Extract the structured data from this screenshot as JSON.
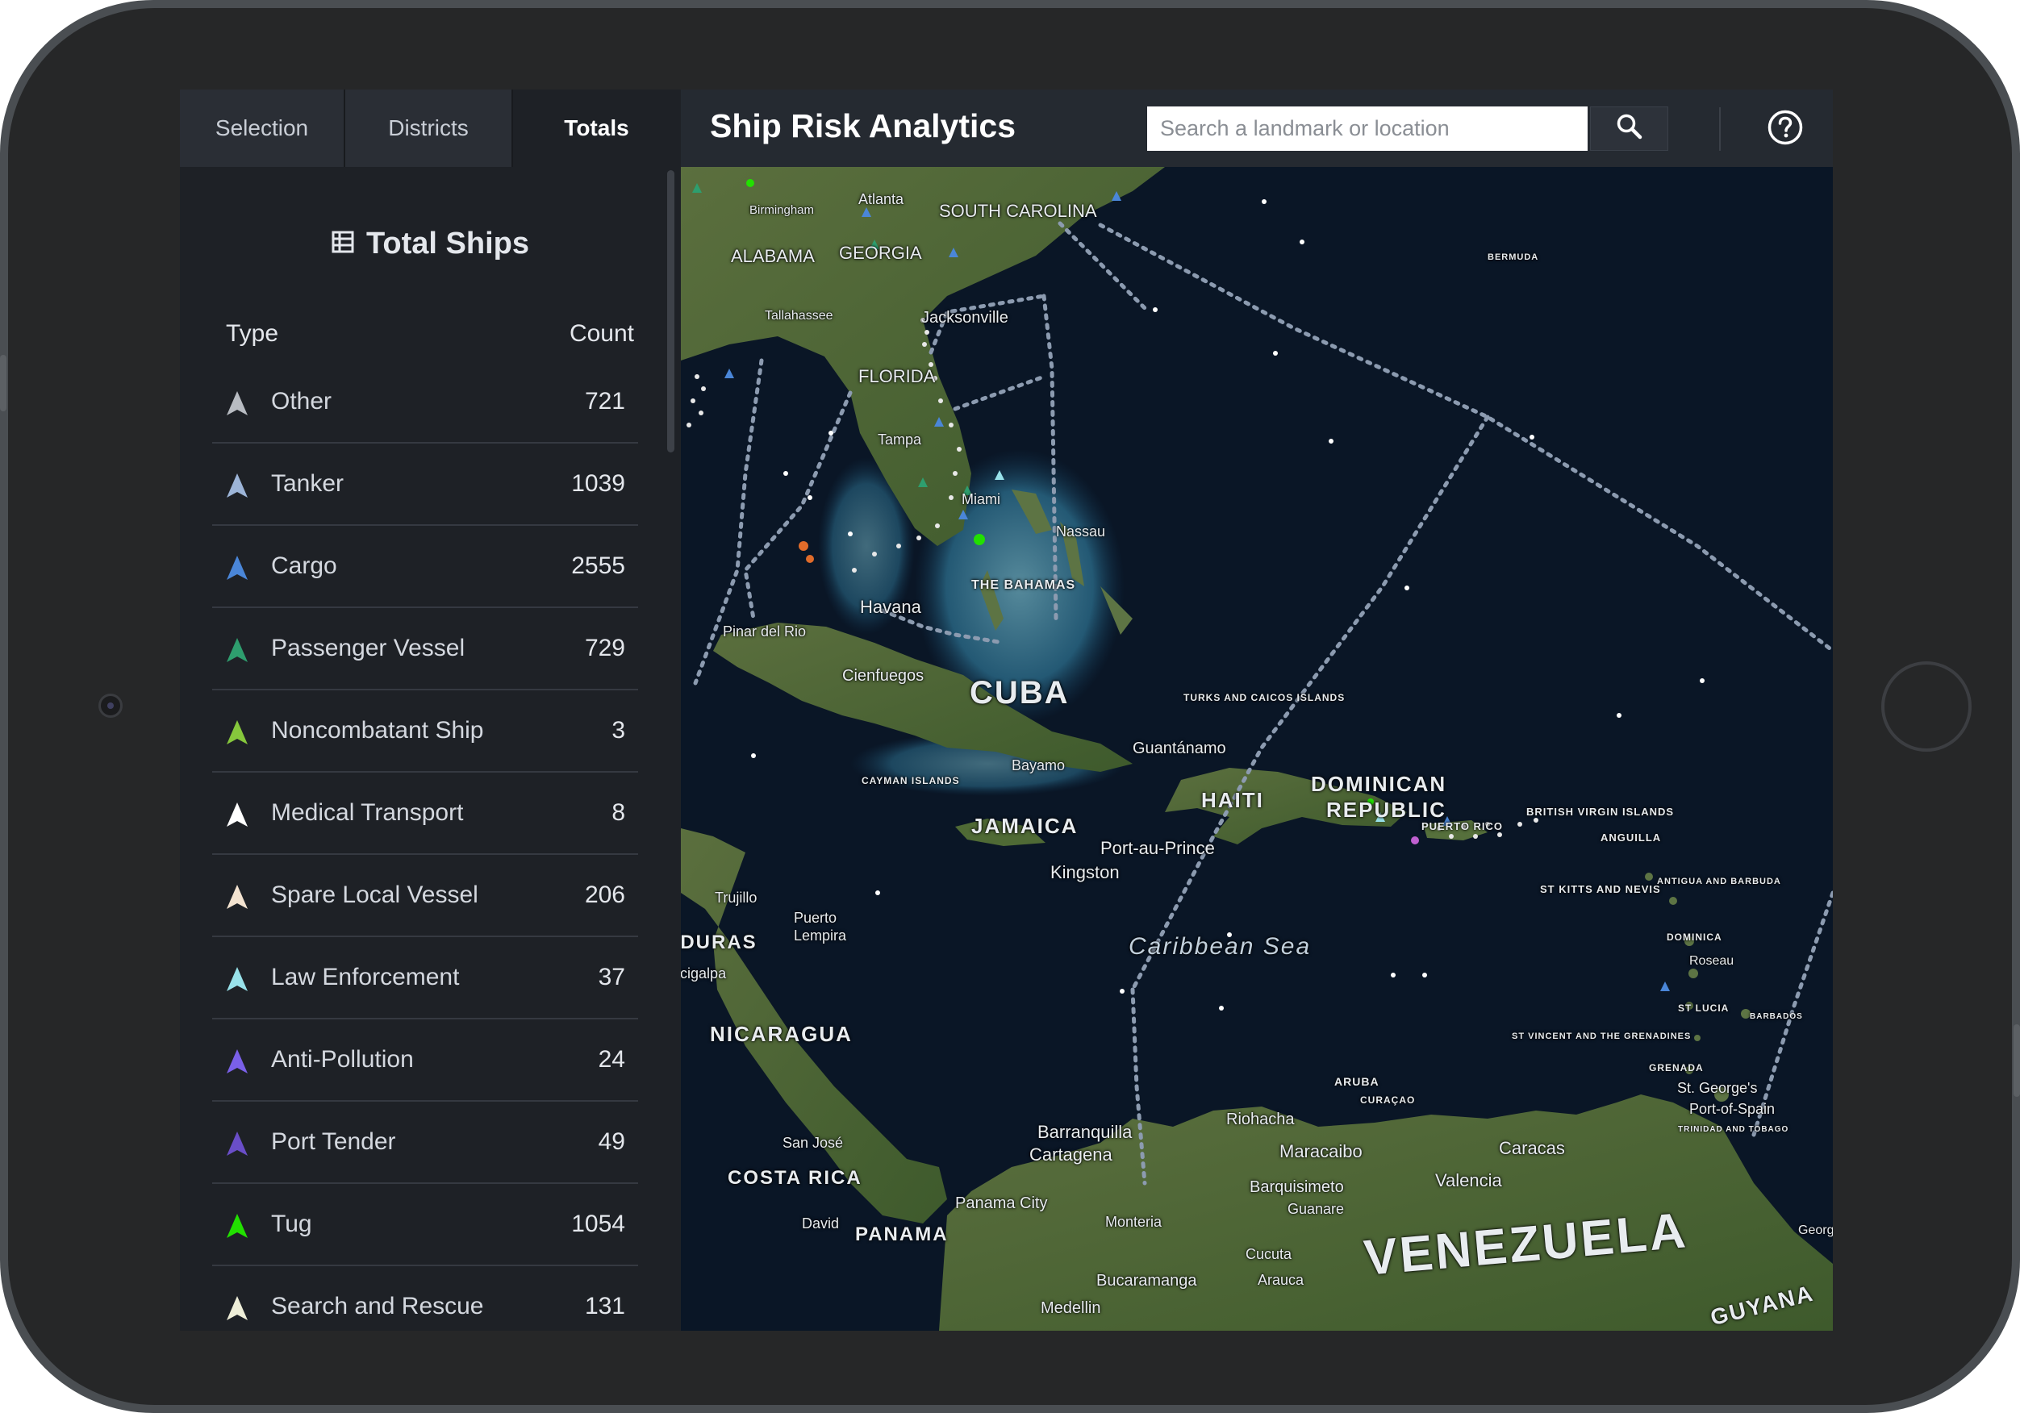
{
  "tabs": [
    {
      "label": "Selection"
    },
    {
      "label": "Districts"
    },
    {
      "label": "Totals"
    }
  ],
  "panel": {
    "title": "Total Ships",
    "col_type": "Type",
    "col_count": "Count",
    "rows": [
      {
        "label": "Other",
        "count": "721",
        "color": "#b8bcc2"
      },
      {
        "label": "Tanker",
        "count": "1039",
        "color": "#9db5d8"
      },
      {
        "label": "Cargo",
        "count": "2555",
        "color": "#4a86d8"
      },
      {
        "label": "Passenger Vessel",
        "count": "729",
        "color": "#2e9e6e"
      },
      {
        "label": "Noncombatant Ship",
        "count": "3",
        "color": "#86c83c"
      },
      {
        "label": "Medical Transport",
        "count": "8",
        "color": "#ffffff"
      },
      {
        "label": "Spare Local Vessel",
        "count": "206",
        "color": "#f3e3d0"
      },
      {
        "label": "Law Enforcement",
        "count": "37",
        "color": "#98e2ea"
      },
      {
        "label": "Anti-Pollution",
        "count": "24",
        "color": "#7a60e8"
      },
      {
        "label": "Port Tender",
        "count": "49",
        "color": "#6a4ec8"
      },
      {
        "label": "Tug",
        "count": "1054",
        "color": "#22e000"
      },
      {
        "label": "Search and Rescue",
        "count": "131",
        "color": "#eeeed8"
      }
    ]
  },
  "header": {
    "title": "Ship Risk Analytics",
    "search_placeholder": "Search a landmark or location",
    "search_icon": "search-icon",
    "help_icon": "help-icon"
  },
  "map": {
    "labels": {
      "south_carolina": "SOUTH CAROLINA",
      "alabama": "ALABAMA",
      "georgia": "GEORGIA",
      "atlanta": "Atlanta",
      "birmingham": "Birmingham",
      "tallahassee": "Tallahassee",
      "jacksonville": "Jacksonville",
      "florida": "FLORIDA",
      "tampa": "Tampa",
      "miami": "Miami",
      "nassau": "Nassau",
      "bahamas": "THE BAHAMAS",
      "bermuda": "BERMUDA",
      "havana": "Havana",
      "pinar": "Pinar del Rio",
      "cienfuegos": "Cienfuegos",
      "cuba": "CUBA",
      "turks": "TURKS AND CAICOS ISLANDS",
      "guantanamo": "Guantánamo",
      "bayamo": "Bayamo",
      "cayman": "CAYMAN ISLANDS",
      "jamaica": "JAMAICA",
      "kingston": "Kingston",
      "haiti": "HAITI",
      "portauprince": "Port-au-Prince",
      "dominican": "DOMINICAN",
      "republic": "REPUBLIC",
      "puertorico": "PUERTO RICO",
      "bvi": "BRITISH VIRGIN ISLANDS",
      "anguilla": "ANGUILLA",
      "stkitts": "ST KITTS AND NEVIS",
      "antigua": "ANTIGUA AND BARBUDA",
      "dominica": "DOMINICA",
      "roseau": "Roseau",
      "stlucia": "ST LUCIA",
      "barbados": "BARBADOS",
      "stvincent": "ST VINCENT AND THE GRENADINES",
      "grenada": "GRENADA",
      "stgeorges": "St. George's",
      "portofspain": "Port-of-Spain",
      "trinidad": "TRINIDAD AND TOBAGO",
      "caribbean": "Caribbean Sea",
      "trujillo": "Trujillo",
      "puertolempira": "Puerto Lempira",
      "honduras": "HONDURAS",
      "tegucigalpa": "Tegucigalpa",
      "nicaragua": "NICARAGUA",
      "sanjose": "San José",
      "costarica": "COSTA RICA",
      "david": "David",
      "panama": "PANAMA",
      "panamacity": "Panama City",
      "barranquilla": "Barranquilla",
      "cartagena": "Cartagena",
      "aruba": "ARUBA",
      "curacao": "CURAÇAO",
      "riohacha": "Riohacha",
      "maracaibo": "Maracaibo",
      "caracas": "Caracas",
      "valencia": "Valencia",
      "barquisimeto": "Barquisimeto",
      "guanare": "Guanare",
      "monteria": "Monteria",
      "cucuta": "Cucuta",
      "arauca": "Arauca",
      "bucaramanga": "Bucaramanga",
      "medellin": "Medellin",
      "venezuela": "VENEZUELA",
      "guyana": "GUYANA",
      "georgetown": "Georgetown"
    }
  },
  "colors": {
    "panel_bg": "#1e2126",
    "header_bg": "#252a31",
    "ocean": "#0a1626"
  }
}
